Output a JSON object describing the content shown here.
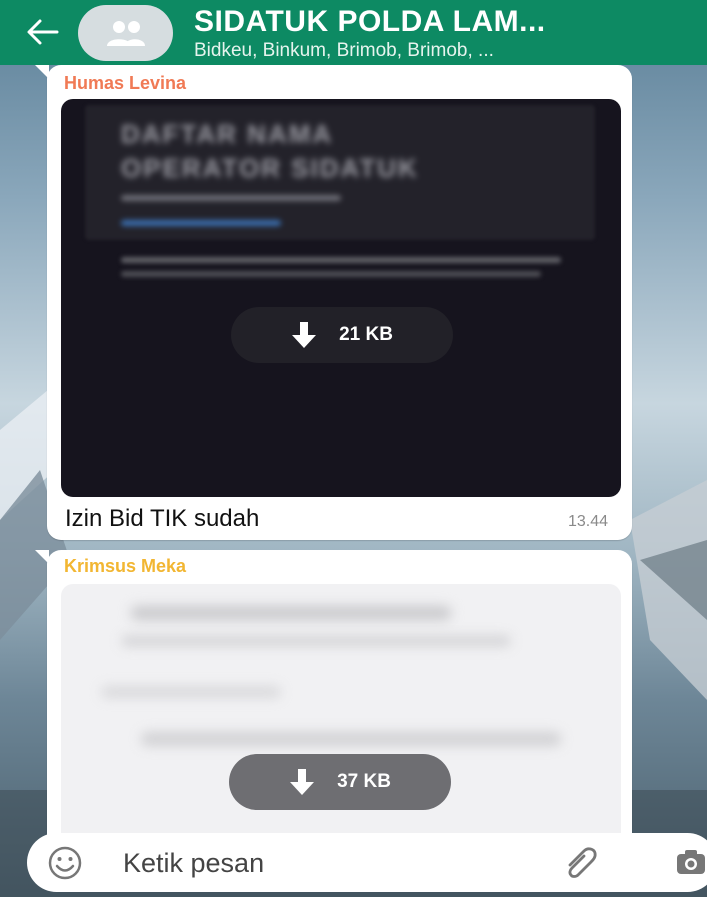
{
  "header": {
    "title": "SIDATUK POLDA LAM...",
    "subtitle": "Bidkeu, Binkum, Brimob, Brimob, ...",
    "back_icon": "arrow-left-icon",
    "avatar_icon": "group-icon",
    "bg_color": "#0d8a63"
  },
  "messages": [
    {
      "sender": "Humas Levina",
      "sender_color": "#f07a55",
      "attachment": {
        "preview_text_line1": "DAFTAR NAMA",
        "preview_text_line2": "OPERATOR SIDATUK",
        "size": "21 KB",
        "icon": "download-icon",
        "theme": "dark"
      },
      "caption": "Izin Bid TIK sudah",
      "time": "13.44"
    },
    {
      "sender": "Krimsus Meka",
      "sender_color": "#f2b632",
      "attachment": {
        "size": "37 KB",
        "icon": "download-icon",
        "theme": "light"
      }
    }
  ],
  "input": {
    "placeholder": "Ketik pesan",
    "emoji_icon": "emoji-icon",
    "attach_icon": "paperclip-icon",
    "camera_icon": "camera-icon"
  }
}
